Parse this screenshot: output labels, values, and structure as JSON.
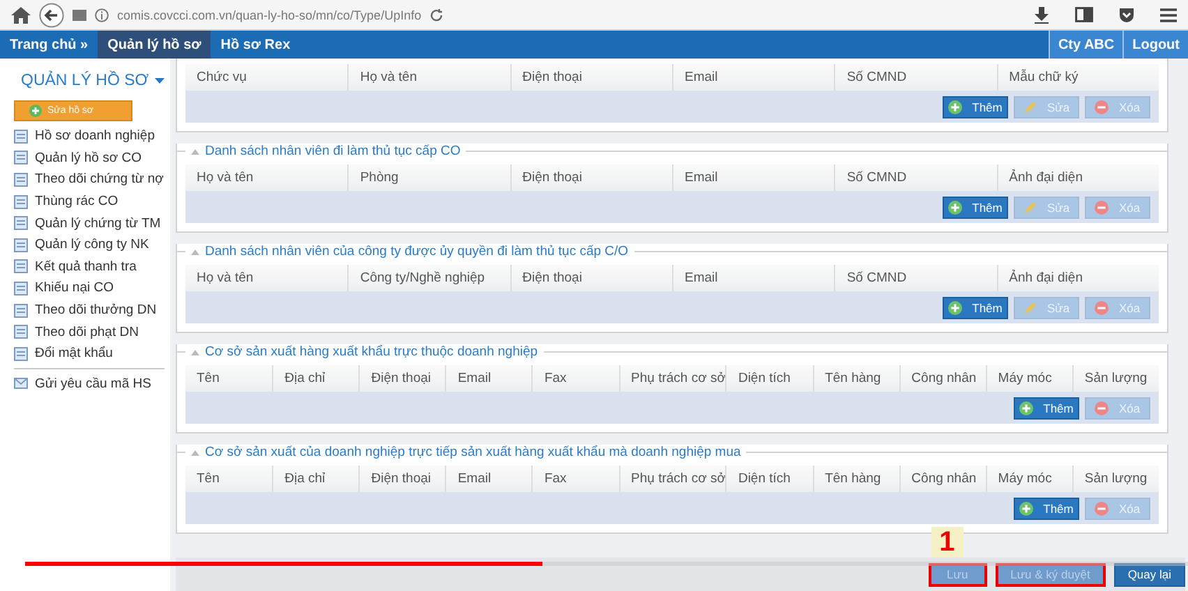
{
  "browser": {
    "url": "comis.covcci.com.vn/quan-ly-ho-so/mn/co/Type/UpInfo"
  },
  "nav": {
    "items": [
      {
        "label": "Trang chủ »",
        "selected": false
      },
      {
        "label": "Quản lý hồ sơ",
        "selected": true
      },
      {
        "label": "Hồ sơ Rex",
        "selected": false
      }
    ],
    "right": [
      "Cty ABC",
      "Logout"
    ]
  },
  "sidebar": {
    "title": "QUẢN LÝ HỒ SƠ",
    "action_button": "Sửa hồ sơ",
    "items": [
      {
        "label": "Hồ sơ doanh nghiệp"
      },
      {
        "label": "Quản lý hồ sơ CO"
      },
      {
        "label": "Theo dõi chứng từ nợ"
      },
      {
        "label": "Thùng rác CO"
      },
      {
        "label": "Quản lý chứng từ TM"
      },
      {
        "label": "Quản lý công ty NK"
      },
      {
        "label": "Kết quả thanh tra"
      },
      {
        "label": "Khiếu nại CO"
      },
      {
        "label": "Theo dõi thưởng DN"
      },
      {
        "label": "Theo dõi phạt DN"
      },
      {
        "label": "Đổi mật khẩu"
      }
    ],
    "extra_item": "Gửi yêu cầu mã HS"
  },
  "sections": [
    {
      "columns": [
        "Chức vụ",
        "Họ và tên",
        "Điện thoại",
        "Email",
        "Số CMND",
        "Mẫu chữ ký"
      ],
      "buttons": [
        {
          "label": "Thêm",
          "kind": "add",
          "disabled": false
        },
        {
          "label": "Sửa",
          "kind": "edit",
          "disabled": true
        },
        {
          "label": "Xóa",
          "kind": "delete",
          "disabled": true
        }
      ]
    },
    {
      "legend": "Danh sách nhân viên đi làm thủ tục cấp CO",
      "columns": [
        "Họ và tên",
        "Phòng",
        "Điện thoại",
        "Email",
        "Số CMND",
        "Ảnh đại diện"
      ],
      "buttons": [
        {
          "label": "Thêm",
          "kind": "add",
          "disabled": false
        },
        {
          "label": "Sửa",
          "kind": "edit",
          "disabled": true
        },
        {
          "label": "Xóa",
          "kind": "delete",
          "disabled": true
        }
      ]
    },
    {
      "legend": "Danh sách nhân viên của công ty được ủy quyền đi làm thủ tục cấp C/O",
      "columns": [
        "Họ và tên",
        "Công ty/Nghề nghiệp",
        "Điện thoại",
        "Email",
        "Số CMND",
        "Ảnh đại diện"
      ],
      "buttons": [
        {
          "label": "Thêm",
          "kind": "add",
          "disabled": false
        },
        {
          "label": "Sửa",
          "kind": "edit",
          "disabled": true
        },
        {
          "label": "Xóa",
          "kind": "delete",
          "disabled": true
        }
      ]
    },
    {
      "legend": "Cơ sở sản xuất hàng xuất khẩu trực thuộc doanh nghiệp",
      "columns": [
        "Tên",
        "Địa chỉ",
        "Điện thoại",
        "Email",
        "Fax",
        "Phụ trách cơ sở",
        "Diện tích",
        "Tên hàng",
        "Công nhân",
        "Máy móc",
        "Sản lượng"
      ],
      "buttons": [
        {
          "label": "Thêm",
          "kind": "add",
          "disabled": false
        },
        {
          "label": "Xóa",
          "kind": "delete",
          "disabled": true
        }
      ]
    },
    {
      "legend": "Cơ sở sản xuất của doanh nghiệp trực tiếp sản xuất hàng xuất khẩu mà doanh nghiệp mua",
      "columns": [
        "Tên",
        "Địa chỉ",
        "Điện thoại",
        "Email",
        "Fax",
        "Phụ trách cơ sở",
        "Diện tích",
        "Tên hàng",
        "Công nhân",
        "Máy móc",
        "Sản lượng"
      ],
      "buttons": [
        {
          "label": "Thêm",
          "kind": "add",
          "disabled": false
        },
        {
          "label": "Xóa",
          "kind": "delete",
          "disabled": true
        }
      ]
    }
  ],
  "footer": {
    "buttons": [
      {
        "label": "Lưu",
        "disabled": true,
        "highlighted": true
      },
      {
        "label": "Lưu & ký duyệt",
        "disabled": true,
        "highlighted": true
      },
      {
        "label": "Quay lại",
        "disabled": false,
        "highlighted": false
      }
    ],
    "annotation": "1"
  },
  "video": {
    "level": 0.445
  }
}
